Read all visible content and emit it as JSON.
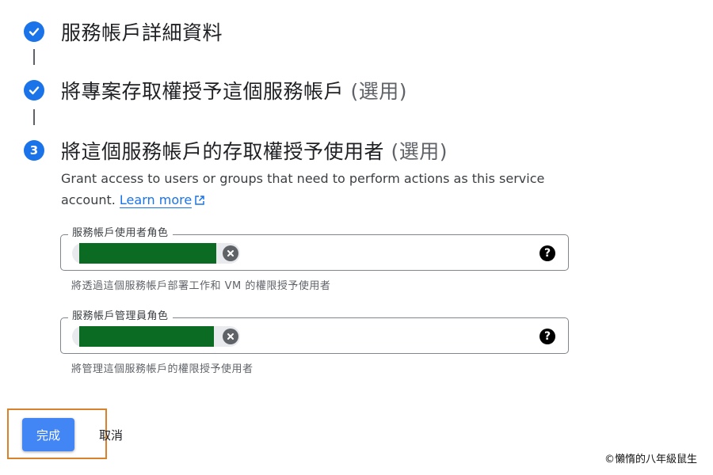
{
  "steps": [
    {
      "number": "",
      "title": "服務帳戶詳細資料",
      "optional": "",
      "state": "completed"
    },
    {
      "number": "",
      "title": "將專案存取權授予這個服務帳戶",
      "optional": "(選用)",
      "state": "completed"
    },
    {
      "number": "3",
      "title": "將這個服務帳戶的存取權授予使用者",
      "optional": "(選用)",
      "state": "active"
    }
  ],
  "description": {
    "text": "Grant access to users or groups that need to perform actions as this service account.",
    "link": "Learn more"
  },
  "fields": [
    {
      "label": "服務帳戶使用者角色",
      "hint": "將透過這個服務帳戶部署工作和 VM 的權限授予使用者",
      "help_icon": "help-icon",
      "chip_remove_icon": "cancel-icon"
    },
    {
      "label": "服務帳戶管理員角色",
      "hint": "將管理這個服務帳戶的權限授予使用者",
      "help_icon": "help-icon",
      "chip_remove_icon": "cancel-icon"
    }
  ],
  "actions": {
    "done": "完成",
    "cancel": "取消"
  },
  "watermark": "©懶惰的八年級鼠生",
  "colors": {
    "accent": "#1a73e8",
    "primary_button": "#4285f4",
    "highlight_border": "#d9822b",
    "redaction": "#0b6b22"
  }
}
